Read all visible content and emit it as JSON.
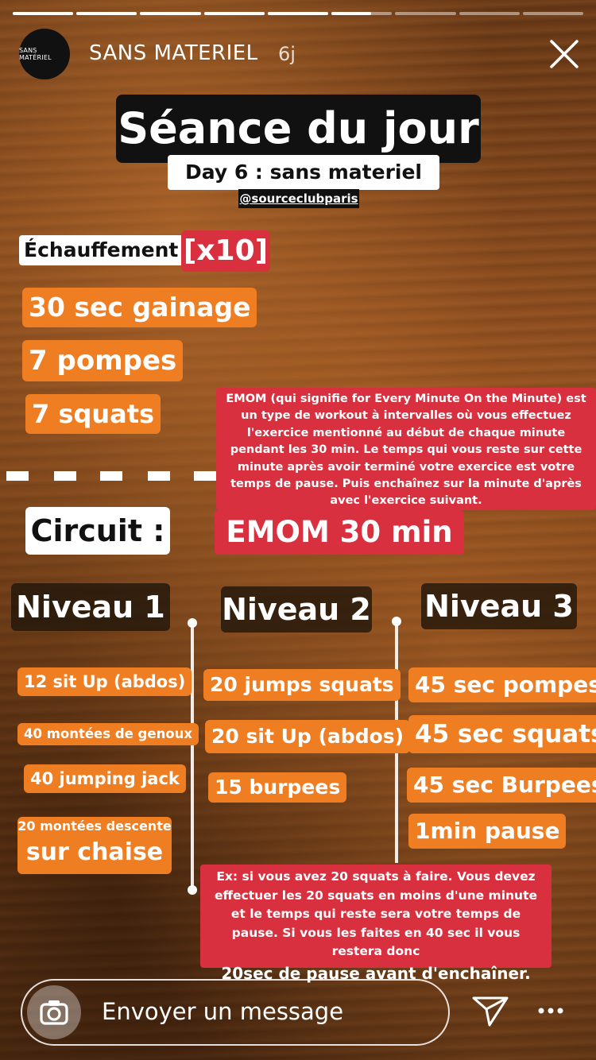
{
  "story": {
    "progress_segments": [
      1,
      1,
      1,
      1,
      1,
      0.65,
      0,
      0,
      0
    ],
    "account": "SANS MATERIEL",
    "avatar_text": "SANS MATÉRIEL",
    "time_ago": "6j"
  },
  "header": {
    "title": "Séance du jour",
    "subtitle": "Day 6 : sans materiel",
    "handle": "@sourceclubparis"
  },
  "warmup": {
    "label": "Échauffement :",
    "reps": "[x10]",
    "items": [
      "30 sec gainage",
      "7 pompes",
      "7 squats"
    ]
  },
  "emom_info": "EMOM (qui signifie for Every Minute On the Minute) est un type de workout à intervalles où vous effectuez l'exercice mentionné au début de chaque minute pendant les 30 min. Le temps qui vous reste sur cette minute après avoir terminé votre exercice est votre temps de pause. Puis enchaînez sur la minute d'après avec l'exercice suivant.",
  "circuit": {
    "label": "Circuit :",
    "format": "EMOM 30 min"
  },
  "levels": {
    "level1": {
      "title": "Niveau 1",
      "items": [
        "12 sit Up (abdos)",
        "40 montées de genoux",
        "40 jumping jack"
      ],
      "last_small": "20 montées descente",
      "last_big": "sur chaise"
    },
    "level2": {
      "title": "Niveau 2",
      "items": [
        "20 jumps squats",
        "20 sit Up (abdos)",
        "15 burpees"
      ]
    },
    "level3": {
      "title": "Niveau 3",
      "items": [
        "45 sec pompes",
        "45 sec squats",
        "45 sec Burpees",
        "1min pause"
      ]
    }
  },
  "example": {
    "text": "Ex: si vous avez 20 squats à faire. Vous devez effectuer les 20 squats en moins d'une minute et le temps qui reste sera votre temps de pause. Si vous les faites en 40 sec il vous restera donc",
    "last_line": "20sec de pause avant d'enchaîner."
  },
  "reply": {
    "placeholder": "Envoyer un message"
  },
  "icons": {
    "close": "close-icon",
    "camera": "camera-icon",
    "send": "send-icon",
    "more": "more-icon"
  },
  "colors": {
    "orange": "#ef7e22",
    "red": "#d9303f",
    "dark": "#111111"
  }
}
